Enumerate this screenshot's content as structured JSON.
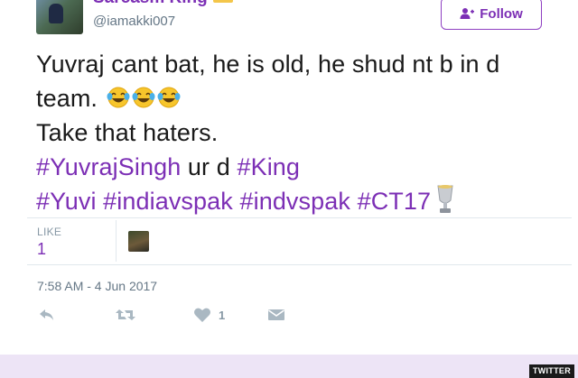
{
  "user": {
    "display_name": "Sarcasm King",
    "handle": "@iamakki007"
  },
  "follow_button": {
    "label": "Follow"
  },
  "tweet": {
    "line1": "Yuvraj cant bat, he is old, he shud nt b in d",
    "line2_text": "team.",
    "line3": "Take that haters.",
    "line4": {
      "hashtag1": "#YuvrajSingh",
      "mid": " ur d ",
      "hashtag2": "#King"
    },
    "line5": {
      "hashtag1": "#Yuvi",
      "hashtag2": "#indiavspak",
      "hashtag3": "#indvspak",
      "hashtag4": "#CT17"
    }
  },
  "stats": {
    "likes_label": "LIKE",
    "likes_count": "1"
  },
  "timestamp": "7:58 AM - 4 Jun 2017",
  "actions": {
    "like_count": "1"
  },
  "watermark": "TWITTER",
  "colors": {
    "accent": "#7c2fb5",
    "muted": "#657786"
  }
}
